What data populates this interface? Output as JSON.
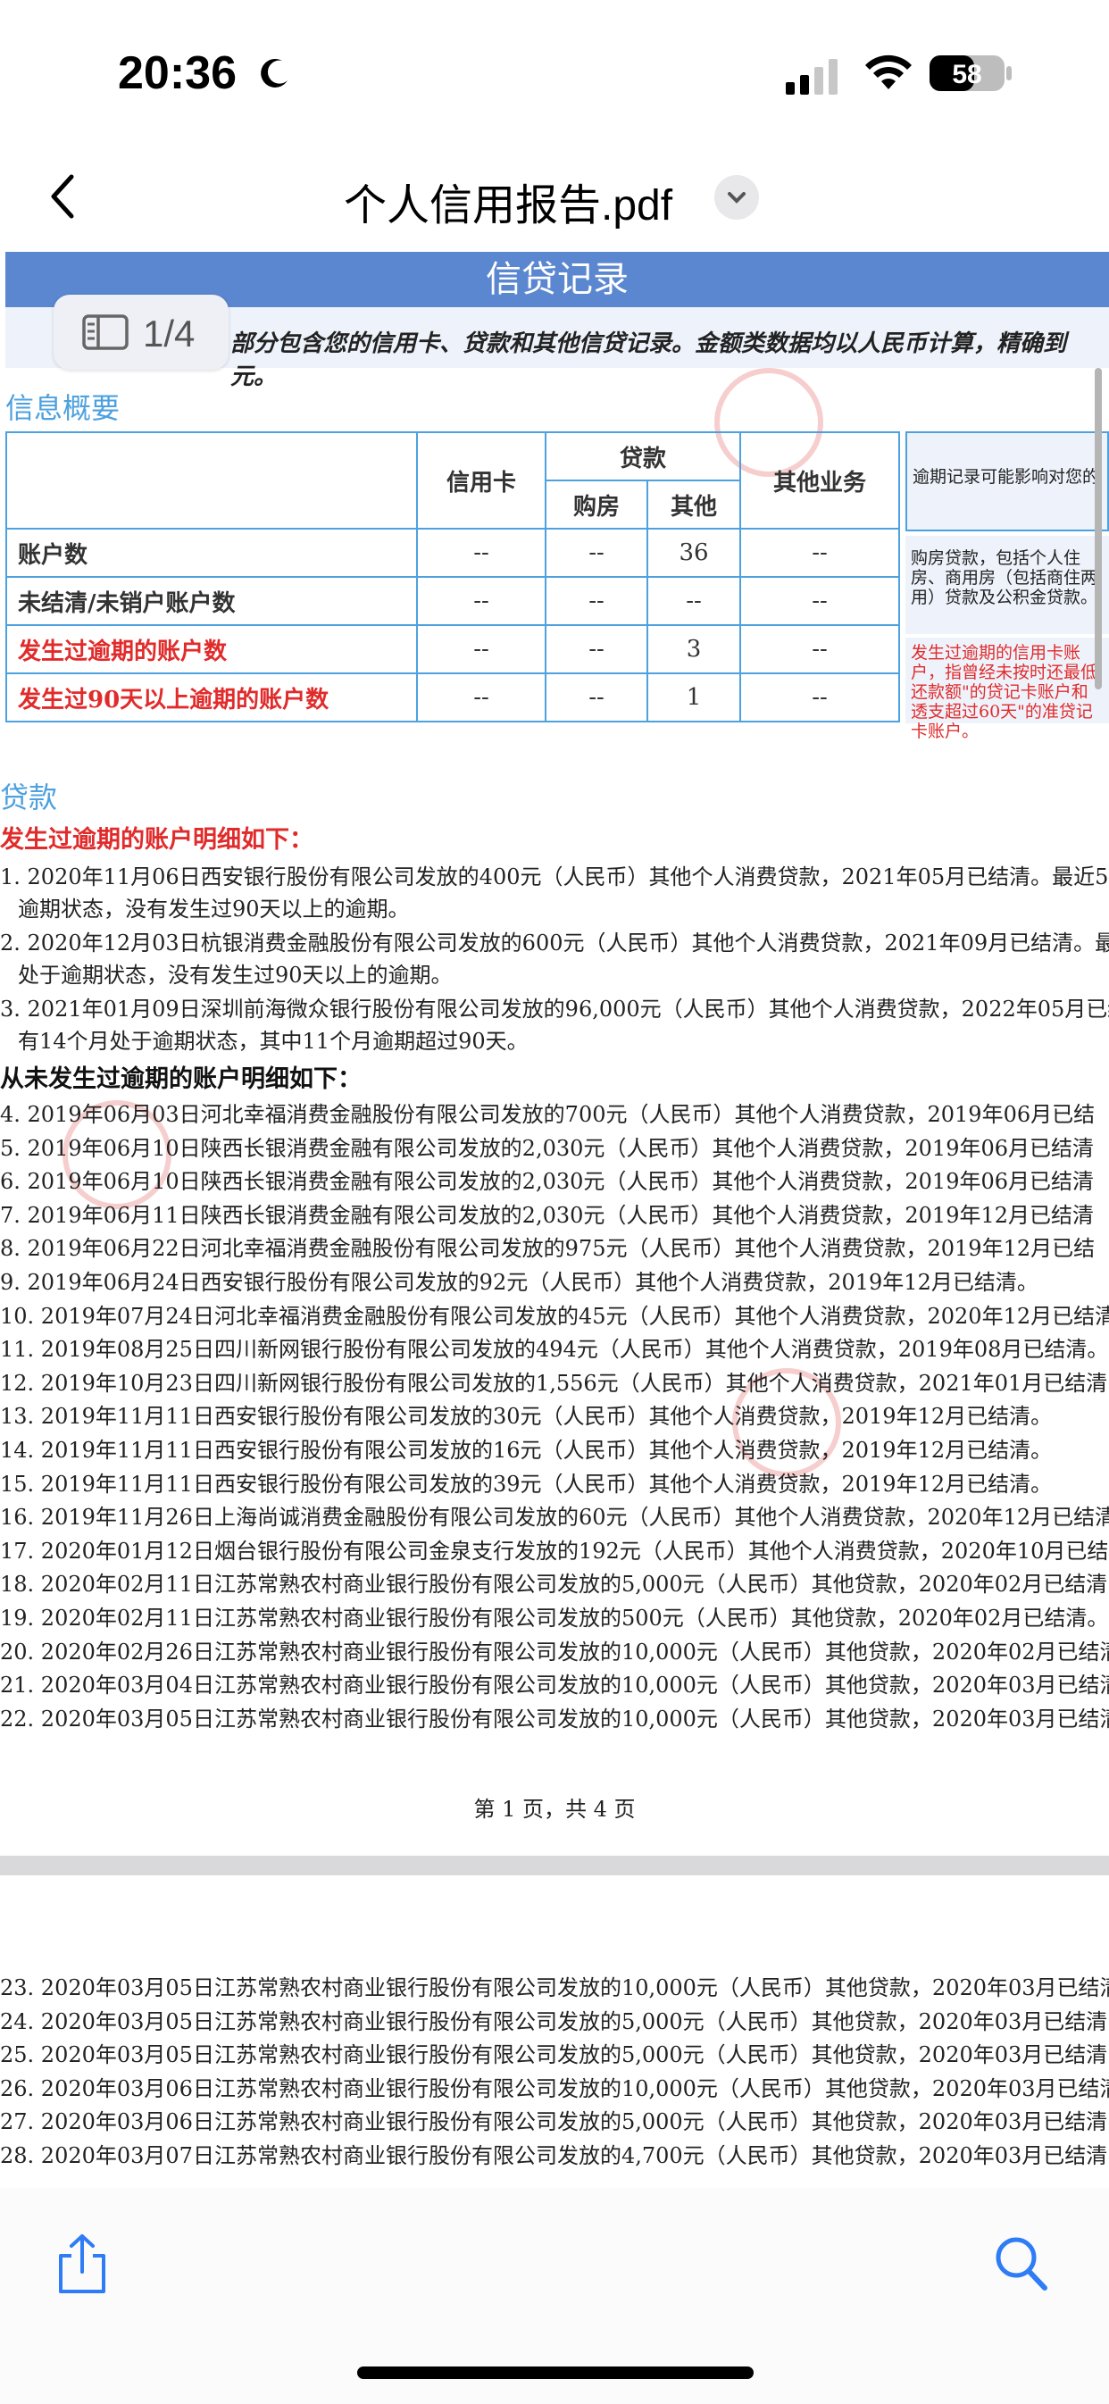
{
  "status": {
    "time": "20:36",
    "battery": "58"
  },
  "nav": {
    "title": "个人信用报告.pdf"
  },
  "page_indicator": "1/4",
  "report": {
    "banner": "信贷记录",
    "subbanner": "部分包含您的信用卡、贷款和其他信贷记录。金额类数据均以人民币计算，精确到元。",
    "summary_title": "信息概要",
    "table": {
      "col_credit": "信用卡",
      "col_loan": "贷款",
      "col_house": "购房",
      "col_other": "其他",
      "col_other_biz": "其他业务",
      "rows": [
        {
          "label": "账户数",
          "v1": "--",
          "v2": "--",
          "v3": "36",
          "v4": "--"
        },
        {
          "label": "未结清/未销户账户数",
          "v1": "--",
          "v2": "--",
          "v3": "--",
          "v4": "--"
        },
        {
          "label": "发生过逾期的账户数",
          "v1": "--",
          "v2": "--",
          "v3": "3",
          "v4": "--"
        },
        {
          "label": "发生过90天以上逾期的账户数",
          "v1": "--",
          "v2": "--",
          "v3": "1",
          "v4": "--"
        }
      ]
    },
    "side_notes": [
      "逾期记录可能影响对您的",
      "购房贷款，包括个人住房、商用房（包括商住两用）贷款及公积金贷款。",
      "发生过逾期的信用卡账户，指曾经未按时还最低还款额\"的贷记卡账户和透支超过60天\"的准贷记卡账户。"
    ],
    "loan_heading": "贷款",
    "overdue_heading": "发生过逾期的账户明细如下：",
    "overdue_items": [
      {
        "text": "1. 2020年11月06日西安银行股份有限公司发放的400元（人民币）其他个人消费贷款，2021年05月已结清。最近5",
        "cont": "逾期状态，没有发生过90天以上的逾期。"
      },
      {
        "text": "2. 2020年12月03日杭银消费金融股份有限公司发放的600元（人民币）其他个人消费贷款，2021年09月已结清。最",
        "cont": "处于逾期状态，没有发生过90天以上的逾期。"
      },
      {
        "text": "3. 2021年01月09日深圳前海微众银行股份有限公司发放的96,000元（人民币）其他个人消费贷款，2022年05月已结",
        "cont": "有14个月处于逾期状态，其中11个月逾期超过90天。"
      }
    ],
    "no_overdue_heading": "从未发生过逾期的账户明细如下：",
    "items": [
      "4.  2019年06月03日河北幸福消费金融股份有限公司发放的700元（人民币）其他个人消费贷款，2019年06月已结",
      "5.  2019年06月10日陕西长银消费金融有限公司发放的2,030元（人民币）其他个人消费贷款，2019年06月已结清",
      "6.  2019年06月10日陕西长银消费金融有限公司发放的2,030元（人民币）其他个人消费贷款，2019年06月已结清",
      "7.  2019年06月11日陕西长银消费金融有限公司发放的2,030元（人民币）其他个人消费贷款，2019年12月已结清",
      "8.  2019年06月22日河北幸福消费金融股份有限公司发放的975元（人民币）其他个人消费贷款，2019年12月已结",
      "9.  2019年06月24日西安银行股份有限公司发放的92元（人民币）其他个人消费贷款，2019年12月已结清。",
      "10. 2019年07月24日河北幸福消费金融股份有限公司发放的45元（人民币）其他个人消费贷款，2020年12月已结清",
      "11. 2019年08月25日四川新网银行股份有限公司发放的494元（人民币）其他个人消费贷款，2019年08月已结清。",
      "12. 2019年10月23日四川新网银行股份有限公司发放的1,556元（人民币）其他个人消费贷款，2021年01月已结清",
      "13. 2019年11月11日西安银行股份有限公司发放的30元（人民币）其他个人消费贷款，2019年12月已结清。",
      "14. 2019年11月11日西安银行股份有限公司发放的16元（人民币）其他个人消费贷款，2019年12月已结清。",
      "15. 2019年11月11日西安银行股份有限公司发放的39元（人民币）其他个人消费贷款，2019年12月已结清。",
      "16. 2019年11月26日上海尚诚消费金融股份有限公司发放的60元（人民币）其他个人消费贷款，2020年12月已结清",
      "17. 2020年01月12日烟台银行股份有限公司金泉支行发放的192元（人民币）其他个人消费贷款，2020年10月已结清",
      "18. 2020年02月11日江苏常熟农村商业银行股份有限公司发放的5,000元（人民币）其他贷款，2020年02月已结清",
      "19. 2020年02月11日江苏常熟农村商业银行股份有限公司发放的500元（人民币）其他贷款，2020年02月已结清。",
      "20. 2020年02月26日江苏常熟农村商业银行股份有限公司发放的10,000元（人民币）其他贷款，2020年02月已结清",
      "21. 2020年03月04日江苏常熟农村商业银行股份有限公司发放的10,000元（人民币）其他贷款，2020年03月已结清",
      "22. 2020年03月05日江苏常熟农村商业银行股份有限公司发放的10,000元（人民币）其他贷款，2020年03月已结清"
    ],
    "page_footer": "第 1 页，共 4 页",
    "page2_items": [
      "23. 2020年03月05日江苏常熟农村商业银行股份有限公司发放的10,000元（人民币）其他贷款，2020年03月已结清",
      "24. 2020年03月05日江苏常熟农村商业银行股份有限公司发放的5,000元（人民币）其他贷款，2020年03月已结清",
      "25. 2020年03月05日江苏常熟农村商业银行股份有限公司发放的5,000元（人民币）其他贷款，2020年03月已结清",
      "26. 2020年03月06日江苏常熟农村商业银行股份有限公司发放的10,000元（人民币）其他贷款，2020年03月已结清",
      "27. 2020年03月06日江苏常熟农村商业银行股份有限公司发放的5,000元（人民币）其他贷款，2020年03月已结清",
      "28. 2020年03月07日江苏常熟农村商业银行股份有限公司发放的4,700元（人民币）其他贷款，2020年03月已结清"
    ]
  }
}
